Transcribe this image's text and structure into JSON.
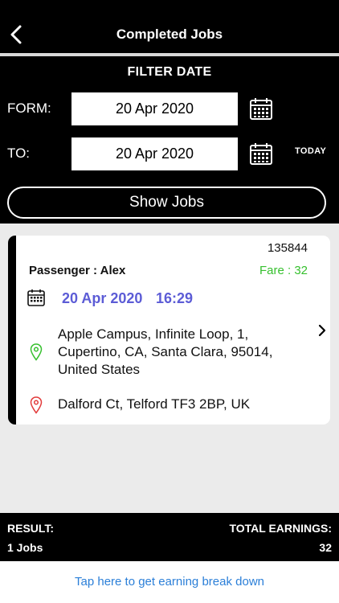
{
  "header": {
    "title": "Completed Jobs",
    "back_icon": "back-chevron-icon"
  },
  "filter": {
    "title": "FILTER DATE",
    "from_label": "FORM:",
    "from_value": "20 Apr 2020",
    "to_label": "TO:",
    "to_value": "20 Apr 2020",
    "today_label": "TODAY",
    "show_button": "Show Jobs",
    "calendar_icon": "calendar-icon"
  },
  "job": {
    "id": "135844",
    "passenger": "Passenger : Alex",
    "fare": "Fare : 32",
    "date": "20 Apr 2020",
    "time": "16:29",
    "pickup": "Apple Campus, Infinite Loop, 1, Cupertino, CA, Santa Clara, 95014, United States",
    "dropoff": "Dalford Ct, Telford TF3 2BP, UK",
    "colors": {
      "fare": "#36c02e",
      "datetime": "#5c5cd6",
      "pickup_pin": "#36c02e",
      "dropoff_pin": "#e23b3b"
    }
  },
  "footer": {
    "result_label": "RESULT:",
    "result_value": "1 Jobs",
    "earnings_label": "TOTAL EARNINGS:",
    "earnings_value": "32"
  },
  "breakdown_link": "Tap here to get earning break down",
  "colors": {
    "link": "#2b7fd8",
    "header_bg": "#000000"
  }
}
